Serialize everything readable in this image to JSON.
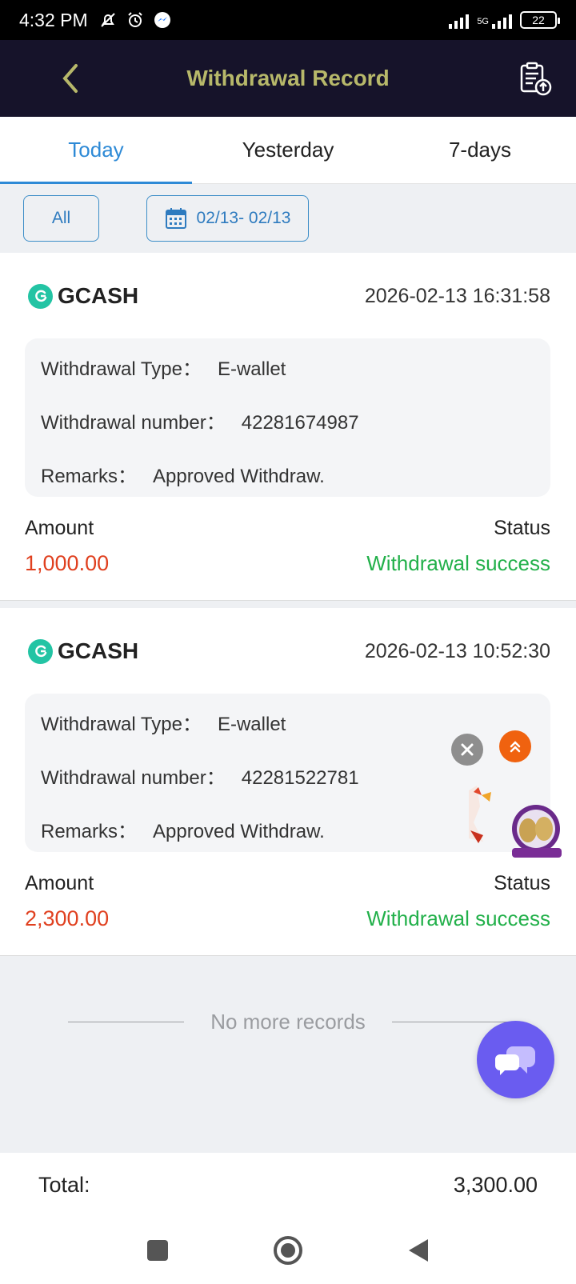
{
  "status_bar": {
    "time": "4:32 PM",
    "network": "5G",
    "battery": "22"
  },
  "header": {
    "title": "Withdrawal Record"
  },
  "tabs": [
    {
      "label": "Today",
      "active": true
    },
    {
      "label": "Yesterday",
      "active": false
    },
    {
      "label": "7-days",
      "active": false
    }
  ],
  "filters": {
    "all_label": "All",
    "date_range": "02/13- 02/13"
  },
  "records": [
    {
      "provider": "GCASH",
      "datetime": "2026-02-13 16:31:58",
      "type_label": "Withdrawal Type：",
      "type_value": "E-wallet",
      "number_label": "Withdrawal number：",
      "number_value": "42281674987",
      "remarks_label": "Remarks：",
      "remarks_value": "Approved Withdraw.",
      "amount_label": "Amount",
      "amount_value": "1,000.00",
      "status_label": "Status",
      "status_value": "Withdrawal success"
    },
    {
      "provider": "GCASH",
      "datetime": "2026-02-13 10:52:30",
      "type_label": "Withdrawal Type：",
      "type_value": "E-wallet",
      "number_label": "Withdrawal number：",
      "number_value": "42281522781",
      "remarks_label": "Remarks：",
      "remarks_value": "Approved Withdraw.",
      "amount_label": "Amount",
      "amount_value": "2,300.00",
      "status_label": "Status",
      "status_value": "Withdrawal success"
    }
  ],
  "list_end": "No more records",
  "footer": {
    "total_label": "Total:",
    "total_value": "3,300.00"
  },
  "colors": {
    "header_bg": "#16132a",
    "title": "#b7b86a",
    "accent": "#2e8ad6",
    "amount": "#e0401f",
    "success": "#22b04a",
    "chat": "#6a5cf0"
  },
  "icons": [
    "bell-off-icon",
    "alarm-icon",
    "messenger-icon",
    "back-chevron-icon",
    "report-upload-icon",
    "calendar-icon",
    "gcash-icon",
    "close-icon",
    "double-chevron-up-icon",
    "chat-icon",
    "nav-square-icon",
    "nav-home-icon",
    "nav-back-icon"
  ]
}
